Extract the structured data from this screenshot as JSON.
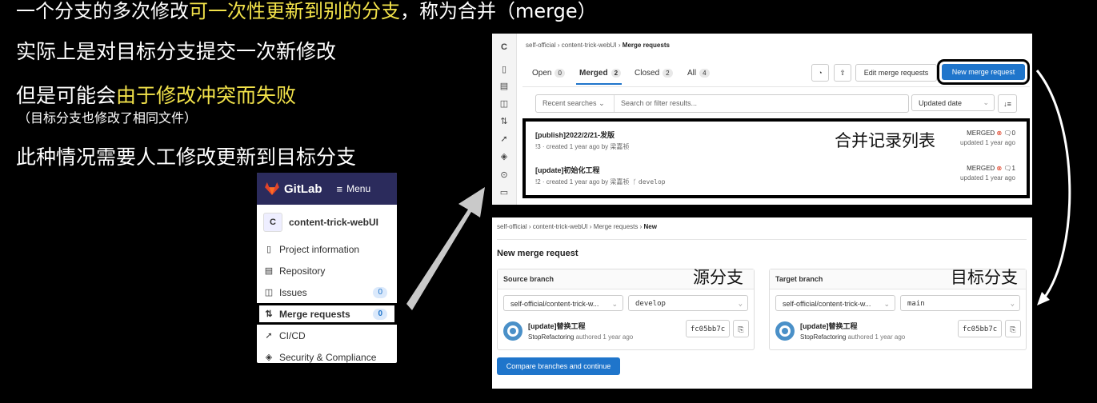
{
  "slide": {
    "line1_pre": "一个分支的多次修改",
    "line1_hl": "可一次性更新到别的分支",
    "line1_post": "，称为合并（merge）",
    "line2": "实际上是对目标分支提交一次新修改",
    "line3_pre": "但是可能会",
    "line3_hl": "由于修改冲突而失败",
    "line3_note": "（目标分支也修改了相同文件）",
    "line4": "此种情况需要人工修改更新到目标分支",
    "colors": {
      "highlight": "#f2e24a",
      "text": "#ffffff",
      "background": "#000000"
    }
  },
  "sidebar": {
    "app_name": "GitLab",
    "menu_label": "Menu",
    "project_initial": "C",
    "project_name": "content-trick-webUI",
    "items": [
      {
        "label": "Project information",
        "icon": "info-icon"
      },
      {
        "label": "Repository",
        "icon": "book-icon"
      },
      {
        "label": "Issues",
        "icon": "issues-icon",
        "count": "0"
      },
      {
        "label": "Merge requests",
        "icon": "merge-request-icon",
        "count": "0"
      },
      {
        "label": "CI/CD",
        "icon": "rocket-icon"
      },
      {
        "label": "Security & Compliance",
        "icon": "shield-icon"
      }
    ]
  },
  "mr_list": {
    "rail_initial": "C",
    "breadcrumb": [
      "self-official",
      "content-trick-webUI",
      "Merge requests"
    ],
    "tabs": [
      {
        "label": "Open",
        "count": "0"
      },
      {
        "label": "Merged",
        "count": "2"
      },
      {
        "label": "Closed",
        "count": "2"
      },
      {
        "label": "All",
        "count": "4"
      }
    ],
    "edit_button": "Edit merge requests",
    "new_button": "New merge request",
    "recent_searches": "Recent searches",
    "search_placeholder": "Search or filter results...",
    "sort_label": "Updated date",
    "annotation": "合并记录列表",
    "rows": [
      {
        "title": "[publish]2022/2/21-发版",
        "meta": "!3 · created 1 year ago by 梁嘉祯",
        "branch": "",
        "status": "MERGED",
        "comments": "0",
        "updated": "updated 1 year ago"
      },
      {
        "title": "[update]初始化工程",
        "meta": "!2 · created 1 year ago by 梁嘉祯",
        "branch": "develop",
        "status": "MERGED",
        "comments": "1",
        "updated": "updated 1 year ago"
      }
    ]
  },
  "mr_new": {
    "breadcrumb": [
      "self-official",
      "content-trick-webUI",
      "Merge requests",
      "New"
    ],
    "title": "New merge request",
    "source": {
      "header": "Source branch",
      "annotation": "源分支",
      "project": "self-official/content-trick-w...",
      "branch": "develop",
      "commit_title": "[update]替换工程",
      "author": "StopRefactoring",
      "authored": "authored 1 year ago",
      "hash": "fc05bb7c"
    },
    "target": {
      "header": "Target branch",
      "annotation": "目标分支",
      "project": "self-official/content-trick-w...",
      "branch": "main",
      "commit_title": "[update]替换工程",
      "author": "StopRefactoring",
      "authored": "authored 1 year ago",
      "hash": "fc05bb7c"
    },
    "compare_button": "Compare branches and continue"
  }
}
